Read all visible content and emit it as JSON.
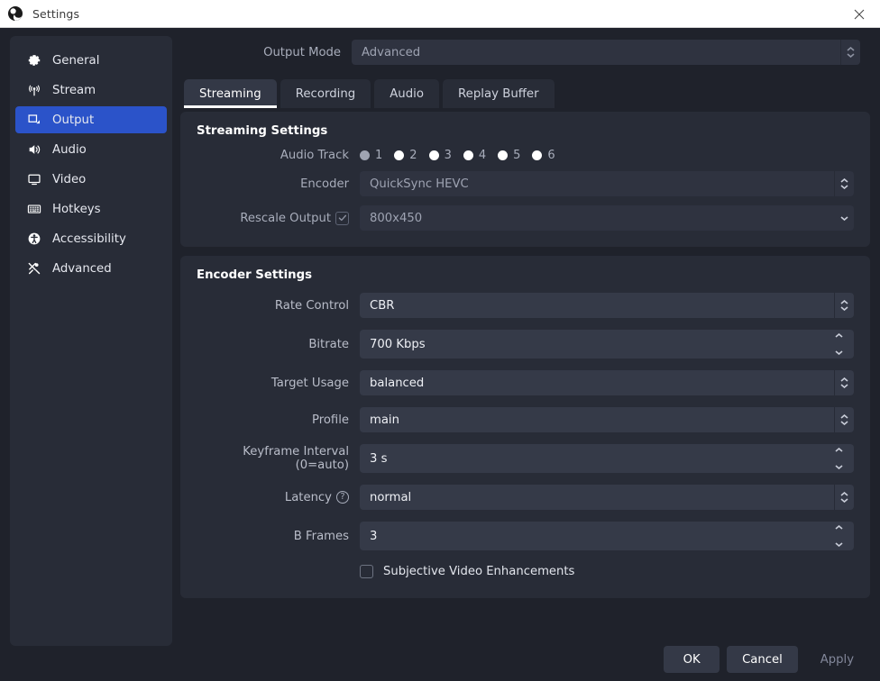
{
  "window": {
    "title": "Settings",
    "logo_icon": "obs-logo-icon",
    "close_icon": "close-icon"
  },
  "sidebar": {
    "items": [
      {
        "label": "General",
        "icon": "gear-icon",
        "active": false
      },
      {
        "label": "Stream",
        "icon": "broadcast-icon",
        "active": false
      },
      {
        "label": "Output",
        "icon": "output-screen-icon",
        "active": true
      },
      {
        "label": "Audio",
        "icon": "speaker-icon",
        "active": false
      },
      {
        "label": "Video",
        "icon": "monitor-icon",
        "active": false
      },
      {
        "label": "Hotkeys",
        "icon": "keyboard-icon",
        "active": false
      },
      {
        "label": "Accessibility",
        "icon": "accessibility-icon",
        "active": false
      },
      {
        "label": "Advanced",
        "icon": "tools-icon",
        "active": false
      }
    ]
  },
  "output_mode": {
    "label": "Output Mode",
    "value": "Advanced",
    "spinner_icon": "updown-chevron-icon"
  },
  "tabs": [
    {
      "label": "Streaming",
      "active": true
    },
    {
      "label": "Recording",
      "active": false
    },
    {
      "label": "Audio",
      "active": false
    },
    {
      "label": "Replay Buffer",
      "active": false
    }
  ],
  "streaming_settings": {
    "title": "Streaming Settings",
    "audio_track": {
      "label": "Audio Track",
      "options": [
        "1",
        "2",
        "3",
        "4",
        "5",
        "6"
      ],
      "selected": "1"
    },
    "encoder": {
      "label": "Encoder",
      "value": "QuickSync HEVC",
      "spinner_icon": "updown-chevron-icon"
    },
    "rescale_output": {
      "label": "Rescale Output",
      "checked": true,
      "value": "800x450",
      "chevron_icon": "chevron-down-icon"
    }
  },
  "encoder_settings": {
    "title": "Encoder Settings",
    "rows": [
      {
        "label": "Rate Control",
        "value": "CBR",
        "control": "combo"
      },
      {
        "label": "Bitrate",
        "value": "700 Kbps",
        "control": "spinbox"
      },
      {
        "label": "Target Usage",
        "value": "balanced",
        "control": "combo"
      },
      {
        "label": "Profile",
        "value": "main",
        "control": "combo"
      },
      {
        "label": "Keyframe Interval (0=auto)",
        "value": "3 s",
        "control": "spinbox"
      },
      {
        "label": "Latency",
        "value": "normal",
        "control": "combo",
        "help_icon": "help-circle-icon"
      },
      {
        "label": "B Frames",
        "value": "3",
        "control": "spinbox"
      }
    ],
    "subjective": {
      "label": "Subjective Video Enhancements",
      "checked": false
    }
  },
  "buttons": {
    "ok": "OK",
    "cancel": "Cancel",
    "apply": "Apply"
  },
  "colors": {
    "accent": "#2b53c9",
    "dialog_bg": "#1f222b",
    "panel_bg": "#282c37",
    "field_bg": "#353a48"
  }
}
